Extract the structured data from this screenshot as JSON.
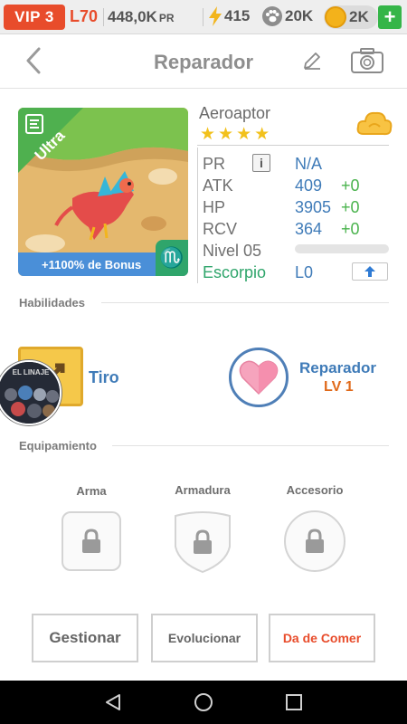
{
  "status_bar": {
    "vip": "VIP 3",
    "level": "L70",
    "power_value": "448,0K",
    "power_label": "PR",
    "energy": "415",
    "food": "20K",
    "gold": "2K",
    "add": "+"
  },
  "header": {
    "title": "Reparador"
  },
  "monster": {
    "name": "Aeroaptor",
    "stars": 4,
    "rarity": "Ultra",
    "bonus": "+1100% de Bonus",
    "zodiac_symbol": "♏"
  },
  "stats": {
    "pr_label": "PR",
    "pr_value": "N/A",
    "info": "i",
    "atk_label": "ATK",
    "atk_value": "409",
    "atk_bonus": "+0",
    "hp_label": "HP",
    "hp_value": "3905",
    "hp_bonus": "+0",
    "rcv_label": "RCV",
    "rcv_value": "364",
    "rcv_bonus": "+0",
    "level_label": "Nivel 05",
    "level_progress": 0,
    "sign_label": "Escorpio",
    "sign_value": "L0"
  },
  "abilities": {
    "section_label": "Habilidades",
    "skill_name": "Tiro",
    "avatar_text": "EL LINAJE",
    "role_name": "Reparador",
    "role_level": "LV 1"
  },
  "equipment": {
    "section_label": "Equipamiento",
    "slots": [
      {
        "label": "Arma"
      },
      {
        "label": "Armadura"
      },
      {
        "label": "Accesorio"
      }
    ]
  },
  "actions": {
    "manage": "Gestionar",
    "evolve": "Evolucionar",
    "feed": "Da de Comer"
  },
  "colors": {
    "accent_red": "#e84c2b",
    "link_blue": "#3f7bb8",
    "green": "#4ab34d",
    "orange": "#e06a1b"
  }
}
